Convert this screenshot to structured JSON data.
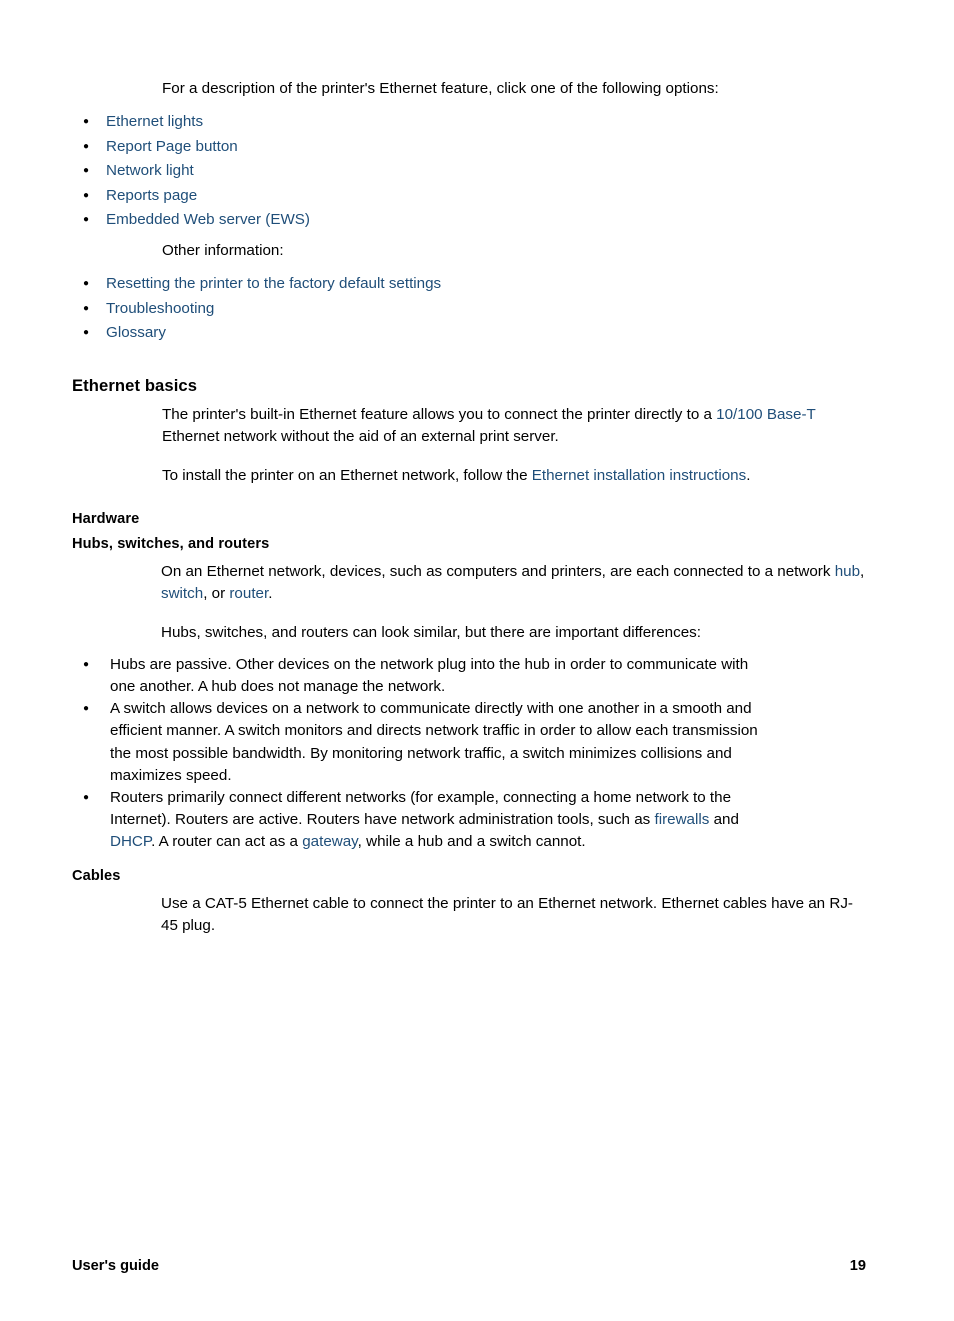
{
  "document": {
    "intro_paragraph": "For a description of the printer's Ethernet feature, click one of the following options:",
    "options_list": [
      "Ethernet lights",
      "Report Page button",
      "Network light",
      "Reports page",
      "Embedded Web server (EWS)"
    ],
    "other_info_label": "Other information:",
    "other_info_list": [
      "Resetting the printer to the factory default settings",
      "Troubleshooting",
      "Glossary"
    ],
    "section_heading": "Ethernet basics",
    "basics_para1": {
      "before_link": "The printer's built-in Ethernet feature allows you to connect the printer directly to a ",
      "link": "10/100 Base-T",
      "after_link": " Ethernet network without the aid of an external print server."
    },
    "basics_para2": {
      "before_link": "To install the printer on an Ethernet network, follow the ",
      "link": "Ethernet installation instructions",
      "after_link": "."
    },
    "hardware_heading": "Hardware",
    "hubs_heading": "Hubs, switches, and routers",
    "hubs_para": {
      "part1": "On an Ethernet network, devices, such as computers and printers, are each connected to a network ",
      "link_hub": "hub",
      "part2": ", ",
      "link_switch": "switch",
      "part3": ", or ",
      "link_router": "router",
      "part4": "."
    },
    "differences_intro": "Hubs, switches, and routers can look similar, but there are important differences:",
    "difference_items": [
      "Hubs are passive. Other devices on the network plug into the hub in order to communicate with one another. A hub does not manage the network.",
      "A switch allows devices on a network to communicate directly with one another in a smooth and efficient manner. A switch monitors and directs network traffic in order to allow each transmission the most possible bandwidth. By monitoring network traffic, a switch minimizes collisions and maximizes speed."
    ],
    "router_item": {
      "part1": "Routers primarily connect different networks (for example, connecting a home network to the Internet). Routers are active. Routers have network administration tools, such as ",
      "link_firewalls": "firewalls",
      "part2": " and ",
      "link_dhcp": "DHCP",
      "part3": ". A router can act as a ",
      "link_gateway": "gateway",
      "part4": ", while a hub and a switch cannot."
    },
    "cables_heading": "Cables",
    "cables_para": "Use a CAT-5 Ethernet cable to connect the printer to an Ethernet network. Ethernet cables have an RJ-45 plug."
  },
  "footer": {
    "label": "User's guide",
    "page_number": "19"
  },
  "colors": {
    "link": "#1F4E79",
    "text": "#000000",
    "background": "#FFFFFF"
  }
}
